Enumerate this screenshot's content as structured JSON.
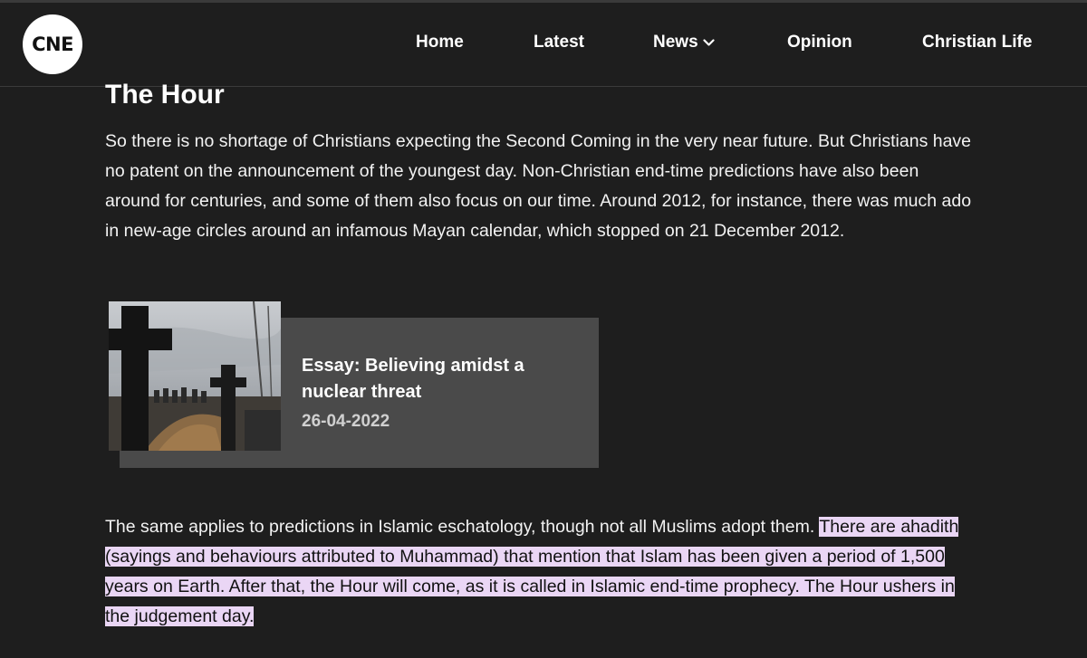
{
  "header": {
    "logo_text": "CNE",
    "nav": {
      "home": "Home",
      "latest": "Latest",
      "news": "News",
      "opinion": "Opinion",
      "christian_life": "Christian Life"
    }
  },
  "article": {
    "heading": "The Hour",
    "paragraph1": "So there is no shortage of Christians expecting the Second Coming in the very near future. But Christians have no patent on the announcement of the youngest day. Non-Christian end-time predictions have also been around for centuries, and some of them also focus on our time. Around 2012, for instance, there was much ado in new-age circles around an infamous Mayan calendar, which stopped on 21 December 2012.",
    "related": {
      "title": "Essay: Believing amidst a nuclear threat",
      "date": "26-04-2022"
    },
    "paragraph2_plain": "The same applies to predictions in Islamic eschatology, though not all Muslims adopt them. ",
    "paragraph2_highlighted": "There are ahadith (sayings and behaviours attributed to Muhammad) that mention that Islam has been given a period of 1,500 years on Earth. After that, the Hour will come, as it is called in Islamic end-time prophecy. The Hour ushers in the judgement day."
  },
  "colors": {
    "background": "#1e1e1e",
    "card": "#4a4a4a",
    "highlight": "#ead6f5"
  },
  "icons": [
    "chevron-down-icon"
  ]
}
